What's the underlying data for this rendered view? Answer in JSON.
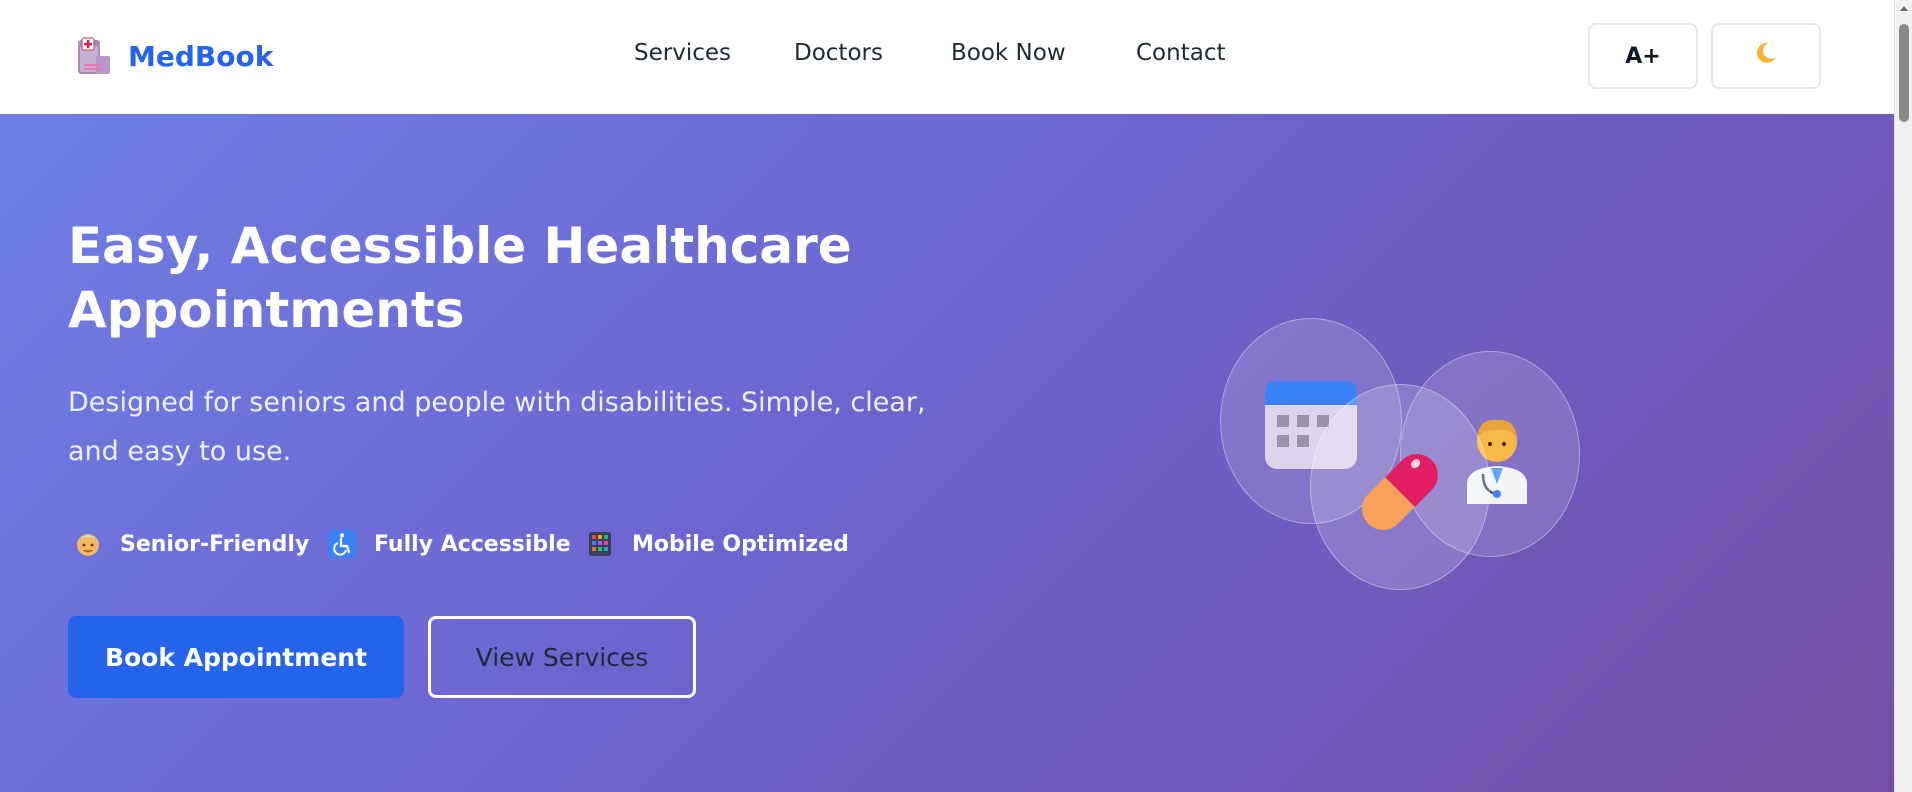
{
  "header": {
    "brand": "MedBook",
    "logo_icon": "hospital-icon",
    "nav": [
      {
        "label": "Services"
      },
      {
        "label": "Doctors"
      },
      {
        "label": "Book Now"
      },
      {
        "label": "Contact"
      }
    ],
    "font_size_button_label": "A+",
    "theme_toggle_icon": "crescent-moon-icon"
  },
  "hero": {
    "title": "Easy, Accessible Healthcare Appointments",
    "subtitle": "Designed for seniors and people with disabilities. Simple, clear, and easy to use.",
    "features": [
      {
        "icon": "older-woman-icon",
        "label": "Senior-Friendly"
      },
      {
        "icon": "wheelchair-icon",
        "label": "Fully Accessible"
      },
      {
        "icon": "mobile-phone-icon",
        "label": "Mobile Optimized"
      }
    ],
    "primary_button": "Book Appointment",
    "secondary_button": "View Services",
    "illustration": [
      "calendar-icon",
      "pill-icon",
      "doctor-icon"
    ]
  },
  "colors": {
    "brand": "#2563eb",
    "hero_gradient_start": "#6d7fe5",
    "hero_gradient_end": "#734fa6"
  }
}
